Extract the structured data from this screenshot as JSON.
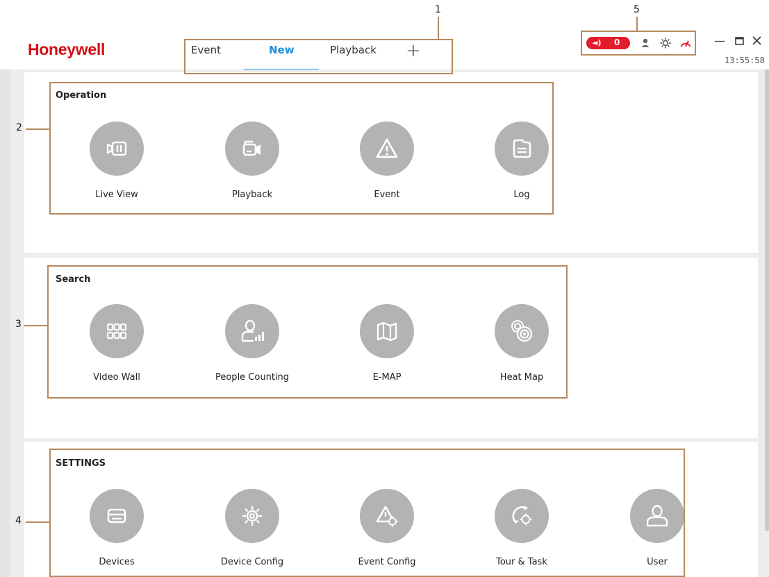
{
  "header": {
    "logo": "Honeywell",
    "tabs": [
      {
        "label": "Event",
        "active": false
      },
      {
        "label": "New",
        "active": true
      },
      {
        "label": "Playback",
        "active": false
      }
    ],
    "add_tab_label": "+",
    "alarm_count": "0",
    "status_icons": [
      "user-icon",
      "settings-gear-icon",
      "performance-gauge-icon"
    ],
    "window_controls": [
      "minimize-icon",
      "maximize-icon",
      "close-icon"
    ],
    "clock": "13:55:58"
  },
  "sections": {
    "operation": {
      "title": "Operation",
      "items": [
        {
          "label": "Live View",
          "icon": "live-view-icon"
        },
        {
          "label": "Playback",
          "icon": "playback-camera-icon"
        },
        {
          "label": "Event",
          "icon": "event-warning-icon"
        },
        {
          "label": "Log",
          "icon": "log-document-icon"
        }
      ]
    },
    "search": {
      "title": "Search",
      "items": [
        {
          "label": "Video Wall",
          "icon": "video-wall-icon"
        },
        {
          "label": "People Counting",
          "icon": "people-counting-icon"
        },
        {
          "label": "E-MAP",
          "icon": "map-icon"
        },
        {
          "label": "Heat Map",
          "icon": "heat-map-icon"
        }
      ]
    },
    "settings": {
      "title": "SETTINGS",
      "items": [
        {
          "label": "Devices",
          "icon": "devices-icon"
        },
        {
          "label": "Device Config",
          "icon": "device-config-gear-icon"
        },
        {
          "label": "Event Config",
          "icon": "event-config-icon"
        },
        {
          "label": "Tour & Task",
          "icon": "tour-task-icon"
        },
        {
          "label": "User",
          "icon": "user-profile-icon"
        }
      ]
    }
  },
  "annotations": [
    "1",
    "2",
    "3",
    "4",
    "5"
  ],
  "colors": {
    "brand": "#d40f14",
    "active_tab": "#1e90d8",
    "tile_circle": "#b3b3b3",
    "annotation": "#b58a5e",
    "alarm": "#e21c2b"
  }
}
